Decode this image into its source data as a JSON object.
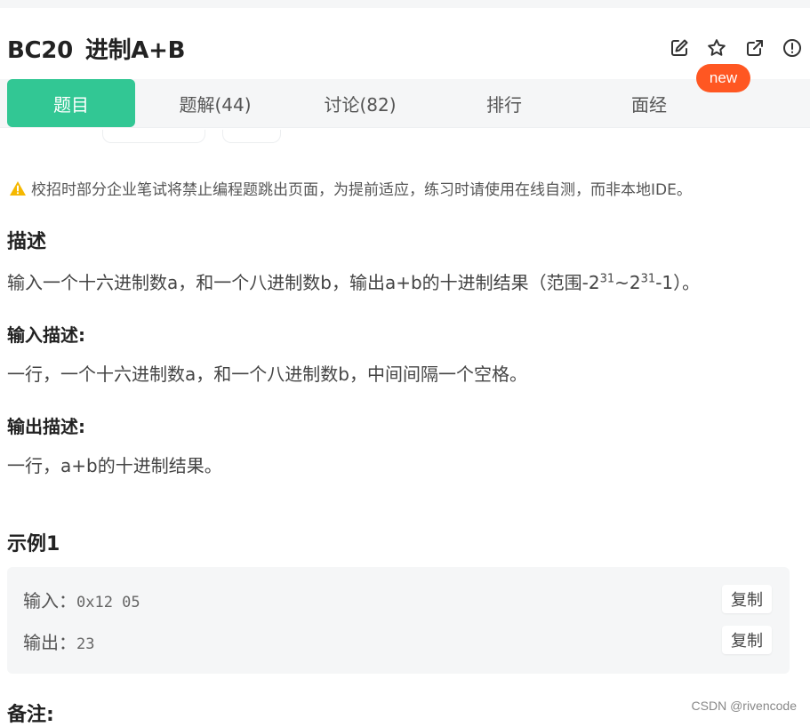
{
  "problem": {
    "code": "BC20",
    "name": "进制A+B"
  },
  "toolbar": {
    "icons": [
      "edit-icon",
      "star-icon",
      "share-icon",
      "report-icon"
    ],
    "new_badge": "new"
  },
  "tabs": [
    {
      "label": "题目",
      "active": true
    },
    {
      "label": "题解(44)"
    },
    {
      "label": "讨论(82)"
    },
    {
      "label": "排行"
    },
    {
      "label": "面经"
    }
  ],
  "notice": "校招时部分企业笔试将禁止编程题跳出页面，为提前适应，练习时请使用在线自测，而非本地IDE。",
  "description": {
    "heading": "描述",
    "text_before": "输入一个十六进制数a，和一个八进制数b，输出a+b的十进制结果（范围-2",
    "exp1": "31",
    "text_mid": "~2",
    "exp2": "31",
    "text_after": "-1）。"
  },
  "input_desc": {
    "heading": "输入描述:",
    "text": "一行，一个十六进制数a，和一个八进制数b，中间间隔一个空格。"
  },
  "output_desc": {
    "heading": "输出描述:",
    "text": "一行，a+b的十进制结果。"
  },
  "example": {
    "heading": "示例1",
    "input_label": "输入：",
    "input_value": "0x12 05",
    "output_label": "输出：",
    "output_value": "23",
    "copy_label": "复制"
  },
  "notes_heading": "备注:",
  "watermark": "CSDN @rivencode",
  "colors": {
    "accent": "#32c794",
    "badge": "#ff5722",
    "warning": "#f5b800"
  }
}
